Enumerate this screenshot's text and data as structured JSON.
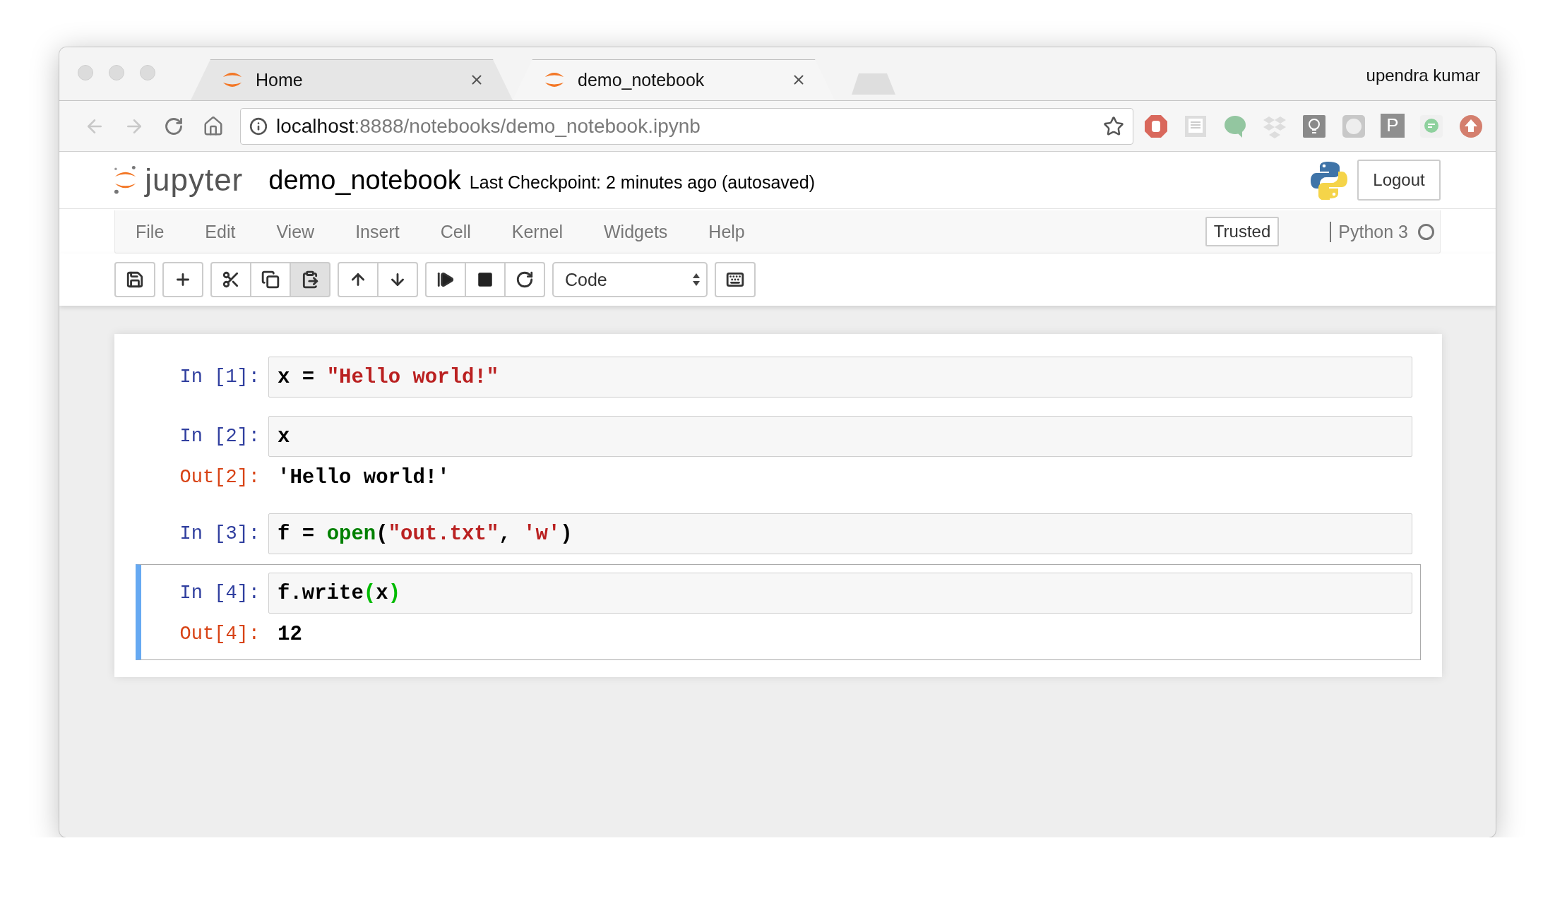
{
  "browser": {
    "tabs": [
      {
        "title": "Home",
        "selected": false
      },
      {
        "title": "demo_notebook",
        "selected": true
      }
    ],
    "profile": "upendra kumar",
    "address": {
      "host": "localhost",
      "rest": ":8888/notebooks/demo_notebook.ipynb"
    },
    "extensions": [
      {
        "kind": "stop-hand"
      },
      {
        "kind": "receipt"
      },
      {
        "kind": "bubble"
      },
      {
        "kind": "boxes"
      },
      {
        "kind": "bulb"
      },
      {
        "kind": "tile"
      },
      {
        "kind": "letter",
        "text": "P"
      },
      {
        "kind": "chat"
      },
      {
        "kind": "upload"
      }
    ]
  },
  "header": {
    "logo_text": "jupyter",
    "notebook_name": "demo_notebook",
    "checkpoint": "Last Checkpoint: 2 minutes ago (autosaved)",
    "logout": "Logout"
  },
  "menubar": {
    "items": [
      "File",
      "Edit",
      "View",
      "Insert",
      "Cell",
      "Kernel",
      "Widgets",
      "Help"
    ],
    "trusted": "Trusted",
    "kernel": {
      "name": "Python 3",
      "busy": false
    }
  },
  "toolbar": [
    {
      "kind": "group",
      "buttons": [
        {
          "kind": "save",
          "highlighted": false
        }
      ]
    },
    {
      "kind": "group",
      "buttons": [
        {
          "kind": "add",
          "highlighted": false
        }
      ]
    },
    {
      "kind": "group",
      "buttons": [
        {
          "kind": "cut",
          "highlighted": false
        },
        {
          "kind": "copy",
          "highlighted": false
        },
        {
          "kind": "paste",
          "highlighted": true
        }
      ]
    },
    {
      "kind": "group",
      "buttons": [
        {
          "kind": "up",
          "highlighted": false
        },
        {
          "kind": "down",
          "highlighted": false
        }
      ]
    },
    {
      "kind": "group",
      "buttons": [
        {
          "kind": "run",
          "highlighted": false
        },
        {
          "kind": "stop",
          "highlighted": false
        },
        {
          "kind": "restart",
          "highlighted": false
        }
      ]
    },
    {
      "kind": "select",
      "value": "Code"
    },
    {
      "kind": "group",
      "buttons": [
        {
          "kind": "keyboard",
          "highlighted": false
        }
      ]
    }
  ],
  "cells": [
    {
      "selected": false,
      "prompt": "In [1]:",
      "code": [
        {
          "kind": "plain",
          "text": "x = "
        },
        {
          "kind": "string",
          "text": "\"Hello world!\""
        }
      ]
    },
    {
      "selected": false,
      "prompt": "In [2]:",
      "code": [
        {
          "kind": "plain",
          "text": "x"
        }
      ],
      "output": {
        "prompt": "Out[2]:",
        "text": "'Hello world!'"
      }
    },
    {
      "selected": false,
      "prompt": "In [3]:",
      "code": [
        {
          "kind": "plain",
          "text": "f = "
        },
        {
          "kind": "builtin",
          "text": "open"
        },
        {
          "kind": "plain",
          "text": "("
        },
        {
          "kind": "string",
          "text": "\"out.txt\""
        },
        {
          "kind": "plain",
          "text": ", "
        },
        {
          "kind": "string",
          "text": "'w'"
        },
        {
          "kind": "plain",
          "text": ")"
        }
      ]
    },
    {
      "selected": true,
      "prompt": "In [4]:",
      "code": [
        {
          "kind": "plain",
          "text": "f.write"
        },
        {
          "kind": "match",
          "text": "("
        },
        {
          "kind": "plain",
          "text": "x"
        },
        {
          "kind": "match",
          "text": ")"
        }
      ],
      "output": {
        "prompt": "Out[4]:",
        "text": "12"
      }
    }
  ]
}
